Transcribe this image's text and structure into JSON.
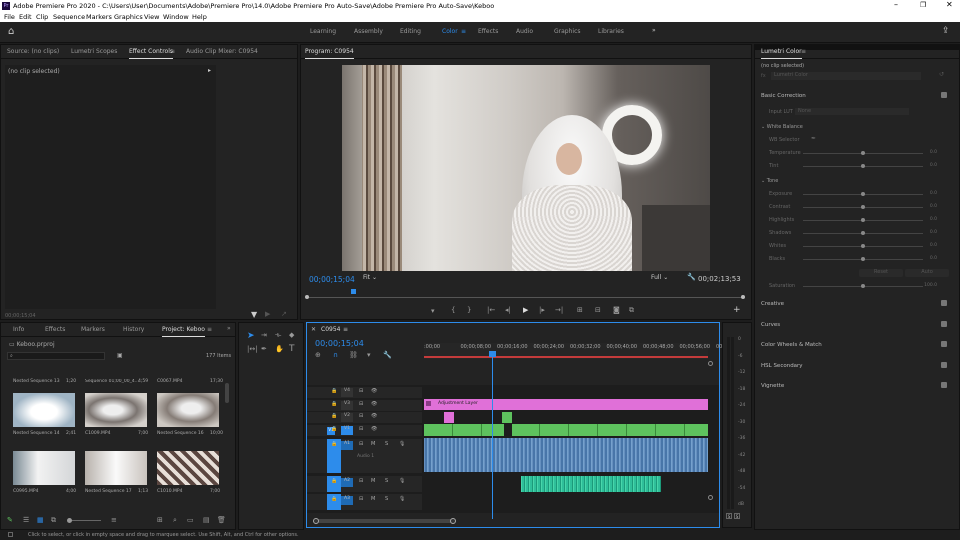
{
  "window": {
    "title": "Adobe Premiere Pro 2020 - C:\\Users\\User\\Documents\\Adobe\\Premiere Pro\\14.0\\Adobe Premiere Pro Auto-Save\\Adobe Premiere Pro Auto-Save\\Keboo",
    "app_icon": "Pr"
  },
  "menu": [
    "File",
    "Edit",
    "Clip",
    "Sequence",
    "Markers",
    "Graphics",
    "View",
    "Window",
    "Help"
  ],
  "workspaces": [
    "Learning",
    "Assembly",
    "Editing",
    "Color",
    "Effects",
    "Audio",
    "Graphics",
    "Libraries"
  ],
  "active_workspace": "Color",
  "source_panel": {
    "tabs": [
      "Source: (no clips)",
      "Lumetri Scopes",
      "Effect Controls",
      "Audio Clip Mixer: C0954"
    ],
    "active": "Effect Controls",
    "no_clip": "(no clip selected)",
    "timecode": "00;00;15;04"
  },
  "program": {
    "title": "Program: C0954",
    "timecode": "00;00;15;04",
    "fit": "Fit",
    "quality": "Full",
    "duration": "00;02;13;53"
  },
  "project_panel": {
    "tabs": [
      "Info",
      "Effects",
      "Markers",
      "History",
      "Project: Keboo"
    ],
    "active": "Project: Keboo",
    "file": "Keboo.prproj",
    "items_count": "177 Items",
    "top_row": [
      {
        "name": "Nested Sequence 13",
        "dur": "1;20"
      },
      {
        "name": "Sequence 01;00_00_4...",
        "dur": "4;59"
      },
      {
        "name": "C0067.MP4",
        "dur": "17;30"
      }
    ],
    "mid_row": [
      {
        "name": "Nested Sequence 14",
        "dur": "2;41"
      },
      {
        "name": "C1009.MP4",
        "dur": "7;00"
      },
      {
        "name": "Nested Sequence 16",
        "dur": "10;00"
      }
    ],
    "bot_row": [
      {
        "name": "C0995.MP4",
        "dur": "4;00"
      },
      {
        "name": "Nested Sequence 17",
        "dur": "1;13"
      },
      {
        "name": "C1010.MP4",
        "dur": "7;00"
      }
    ]
  },
  "timeline": {
    "tab": "C0954",
    "timecode": "00;00;15;04",
    "ruler": [
      ":00;00",
      "00;00;08;00",
      "00;00;16;00",
      "00;00;24;00",
      "00;00;32;00",
      "00;00;40;00",
      "00;00;48;00",
      "00;00;56;00",
      "00"
    ],
    "tracks_video": [
      "V4",
      "V3",
      "V2",
      "V1"
    ],
    "tracks_audio": [
      "A1",
      "A2",
      "A3"
    ],
    "audio_label": "Audio 1",
    "adjustment_layer": "Adjustment Layer",
    "track_btn_m": "M",
    "track_btn_s": "S",
    "target_v1": "V1"
  },
  "meter": {
    "scale": [
      "0",
      "-6",
      "-12",
      "-18",
      "-24",
      "-30",
      "-36",
      "-42",
      "-48",
      "-54",
      "dB"
    ],
    "solo": "S",
    "solo2": "S"
  },
  "lumetri": {
    "title": "Lumetri Color",
    "no_clip": "(no clip selected)",
    "fx_prefix": "fx",
    "clip_field": "Lumetri Color",
    "basic": "Basic Correction",
    "input_lut": "Input LUT",
    "input_lut_val": "None",
    "white_balance": "White Balance",
    "wb_selector": "WB Selector",
    "wb_sliders": [
      {
        "name": "Temperature",
        "value": "0.0",
        "pos": 0.5
      },
      {
        "name": "Tint",
        "value": "0.0",
        "pos": 0.5
      }
    ],
    "tone": "Tone",
    "tone_sliders": [
      {
        "name": "Exposure",
        "value": "0.0",
        "pos": 0.5
      },
      {
        "name": "Contrast",
        "value": "0.0",
        "pos": 0.5
      },
      {
        "name": "Highlights",
        "value": "0.0",
        "pos": 0.5
      },
      {
        "name": "Shadows",
        "value": "0.0",
        "pos": 0.5
      },
      {
        "name": "Whites",
        "value": "0.0",
        "pos": 0.5
      },
      {
        "name": "Blacks",
        "value": "0.0",
        "pos": 0.5
      }
    ],
    "reset": "Reset",
    "auto": "Auto",
    "saturation": {
      "name": "Saturation",
      "value": "100.0",
      "pos": 0.5
    },
    "sections": [
      "Creative",
      "Curves",
      "Color Wheels & Match",
      "HSL Secondary",
      "Vignette"
    ]
  },
  "status": "Click to select, or click in empty space and drag to marquee select. Use Shift, Alt, and Ctrl for other options.",
  "colors": {
    "accent": "#2d8ceb",
    "pink": "#e070d8",
    "green": "#5ec25e",
    "audio": "#4a7ab0",
    "teal": "#2fbf9a"
  }
}
